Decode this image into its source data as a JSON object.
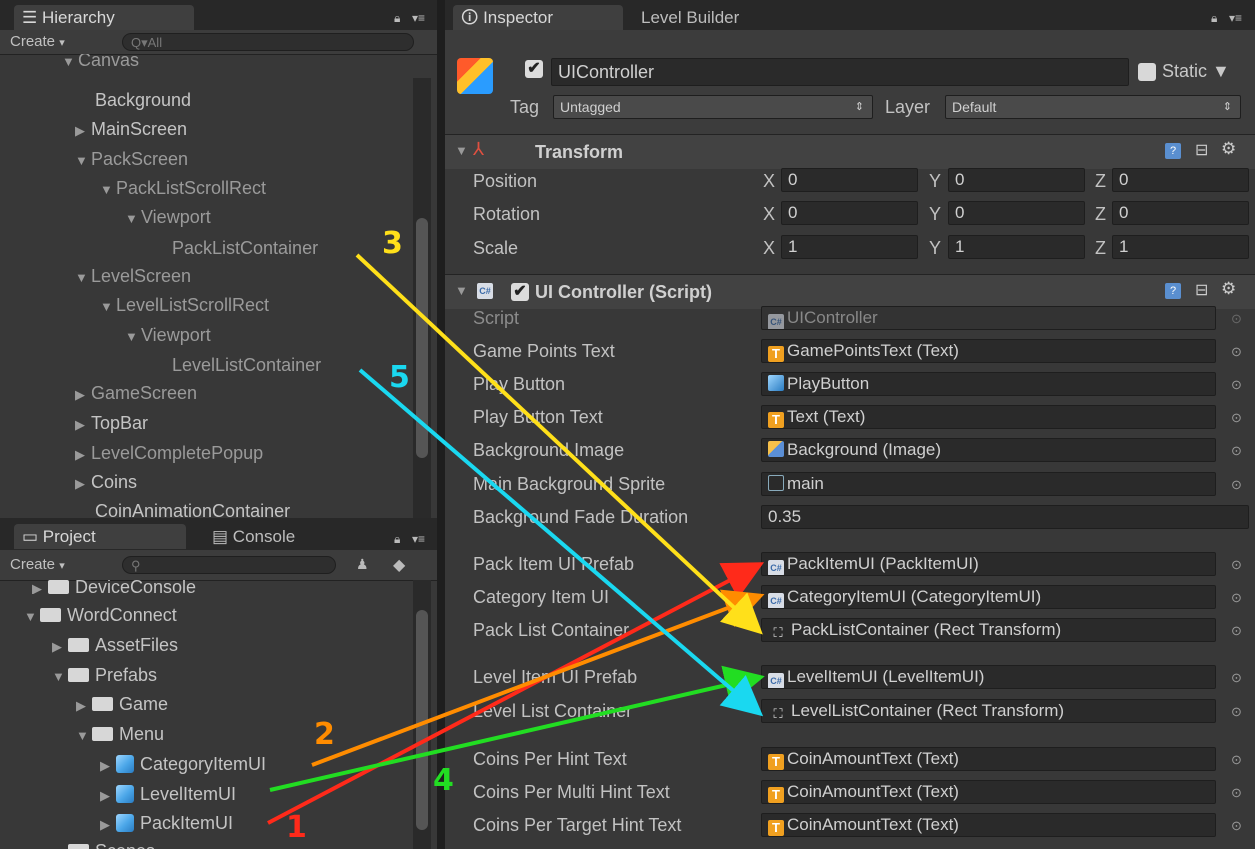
{
  "hierarchy": {
    "tab_label": "Hierarchy",
    "create_label": "Create",
    "search_placeholder": "Q▾All",
    "items": [
      {
        "label": "Canvas",
        "indent": 1
      },
      {
        "label": "Background"
      },
      {
        "label": "MainScreen"
      },
      {
        "label": "PackScreen"
      },
      {
        "label": "PackListScrollRect"
      },
      {
        "label": "Viewport"
      },
      {
        "label": "PackListContainer"
      },
      {
        "label": "LevelScreen"
      },
      {
        "label": "LevelListScrollRect"
      },
      {
        "label": "Viewport"
      },
      {
        "label": "LevelListContainer"
      },
      {
        "label": "GameScreen"
      },
      {
        "label": "TopBar"
      },
      {
        "label": "LevelCompletePopup"
      },
      {
        "label": "Coins"
      },
      {
        "label": "CoinAnimationContainer"
      }
    ]
  },
  "project": {
    "tab_label": "Project",
    "console_tab_label": "Console",
    "create_label": "Create",
    "items": [
      {
        "label": "DeviceConsole"
      },
      {
        "label": "WordConnect"
      },
      {
        "label": "AssetFiles"
      },
      {
        "label": "Prefabs"
      },
      {
        "label": "Game"
      },
      {
        "label": "Menu"
      },
      {
        "label": "CategoryItemUI"
      },
      {
        "label": "LevelItemUI"
      },
      {
        "label": "PackItemUI"
      },
      {
        "label": "Scenes"
      }
    ]
  },
  "inspector": {
    "tab_label": "Inspector",
    "level_builder_tab_label": "Level Builder",
    "object_name": "UIController",
    "static_label": "Static",
    "tag_label": "Tag",
    "tag_value": "Untagged",
    "layer_label": "Layer",
    "layer_value": "Default",
    "transform": {
      "title": "Transform",
      "rows": [
        {
          "label": "Position",
          "x": "0",
          "y": "0",
          "z": "0"
        },
        {
          "label": "Rotation",
          "x": "0",
          "y": "0",
          "z": "0"
        },
        {
          "label": "Scale",
          "x": "1",
          "y": "1",
          "z": "1"
        }
      ]
    },
    "script_component": {
      "title": "UI Controller (Script)",
      "fields": [
        {
          "label": "Script",
          "value": "UIController",
          "icon": "cs"
        },
        {
          "label": "Game Points Text",
          "value": "GamePointsText (Text)",
          "icon": "t"
        },
        {
          "label": "Play Button",
          "value": "PlayButton",
          "icon": "cube"
        },
        {
          "label": "Play Button Text",
          "value": "Text (Text)",
          "icon": "t"
        },
        {
          "label": "Background Image",
          "value": "Background (Image)",
          "icon": "img"
        },
        {
          "label": "Main Background Sprite",
          "value": "main",
          "icon": "sprite"
        },
        {
          "label": "Background Fade Duration",
          "value": "0.35",
          "icon": "none"
        },
        {
          "label": "Pack Item UI Prefab",
          "value": "PackItemUI (PackItemUI)",
          "icon": "cs"
        },
        {
          "label": "Category Item UI",
          "value": "CategoryItemUI (CategoryItemUI)",
          "icon": "cs"
        },
        {
          "label": "Pack List Container",
          "value": "PackListContainer (Rect Transform)",
          "icon": "rect"
        },
        {
          "label": "Level Item UI Prefab",
          "value": "LevelItemUI (LevelItemUI)",
          "icon": "cs"
        },
        {
          "label": "Level List Container",
          "value": "LevelListContainer (Rect Transform)",
          "icon": "rect"
        },
        {
          "label": "Coins Per Hint Text",
          "value": "CoinAmountText (Text)",
          "icon": "t"
        },
        {
          "label": "Coins Per Multi Hint Text",
          "value": "CoinAmountText (Text)",
          "icon": "t"
        },
        {
          "label": "Coins Per Target Hint Text",
          "value": "CoinAmountText (Text)",
          "icon": "t"
        }
      ]
    }
  },
  "annotations": [
    {
      "label": "1",
      "color": "#ff2a1a"
    },
    {
      "label": "2",
      "color": "#ff8c00"
    },
    {
      "label": "3",
      "color": "#ffe01a"
    },
    {
      "label": "4",
      "color": "#22dd22"
    },
    {
      "label": "5",
      "color": "#1ad8f0"
    }
  ]
}
